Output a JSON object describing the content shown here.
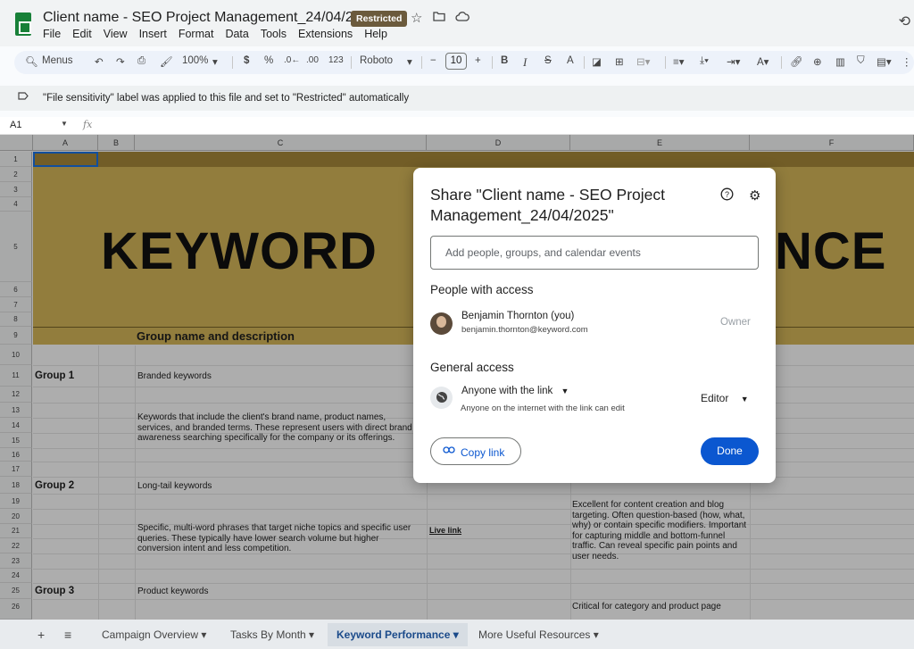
{
  "titlebar": {
    "title": "Client name - SEO Project Management_24/04/2025",
    "badge": "Restricted",
    "menu": [
      "File",
      "Edit",
      "View",
      "Insert",
      "Format",
      "Data",
      "Tools",
      "Extensions",
      "Help"
    ]
  },
  "toolbar": {
    "menus_label": "Menus",
    "zoom": "100%",
    "currency": "$",
    "percent": "%",
    "decrease_decimal": ".0←",
    "increase_decimal": ".00",
    "number_format": "123",
    "font": "Roboto",
    "font_size": "10"
  },
  "banner": {
    "text": "\"File sensitivity\" label was applied to this file and set to \"Restricted\" automatically"
  },
  "formula_bar": {
    "cell_ref": "A1",
    "fx": "fx"
  },
  "grid": {
    "columns": [
      "A",
      "B",
      "C",
      "D",
      "E",
      "F"
    ],
    "rows": [
      "1",
      "2",
      "3",
      "4",
      "5",
      "6",
      "7",
      "8",
      "9",
      "10",
      "11",
      "12",
      "13",
      "14",
      "15",
      "16",
      "17",
      "18",
      "19",
      "20",
      "21",
      "22",
      "23",
      "24",
      "25",
      "26"
    ],
    "big_title_left": "KEYWORD",
    "big_title_right": "NCE",
    "header_cell": "Group name and description",
    "groups": [
      {
        "label": "Group 1",
        "name": "Branded keywords",
        "description": "Keywords that include the client's brand name, product names, services, and branded terms. These represent users with direct brand awareness searching specifically for the company or its offerings."
      },
      {
        "label": "Group 2",
        "name": "Long-tail keywords",
        "description": "Specific, multi-word phrases that target niche topics and specific user queries. These typically have lower search volume but higher conversion intent and less competition.",
        "link": "Live link",
        "notes": "Excellent for content creation and blog targeting. Often question-based (how, what, why) or contain specific modifiers. Important for capturing middle and bottom-funnel traffic. Can reveal specific pain points and user needs."
      },
      {
        "label": "Group 3",
        "name": "Product keywords",
        "notes": "Critical for category and product page"
      }
    ]
  },
  "sheets": {
    "tabs": [
      "Campaign Overview",
      "Tasks By Month",
      "Keyword Performance",
      "More Useful Resources"
    ],
    "active": "Keyword Performance"
  },
  "dialog": {
    "title": "Share \"Client name - SEO Project Management_24/04/2025\"",
    "input_placeholder": "Add people, groups, and calendar events",
    "people_heading": "People with access",
    "person": {
      "name": "Benjamin Thornton (you)",
      "email": "benjamin.thornton@keyword.com",
      "role": "Owner"
    },
    "general_heading": "General access",
    "access_type": "Anyone with the link",
    "access_description": "Anyone on the internet with the link can edit",
    "access_role": "Editor",
    "copy_link": "Copy link",
    "done": "Done"
  }
}
